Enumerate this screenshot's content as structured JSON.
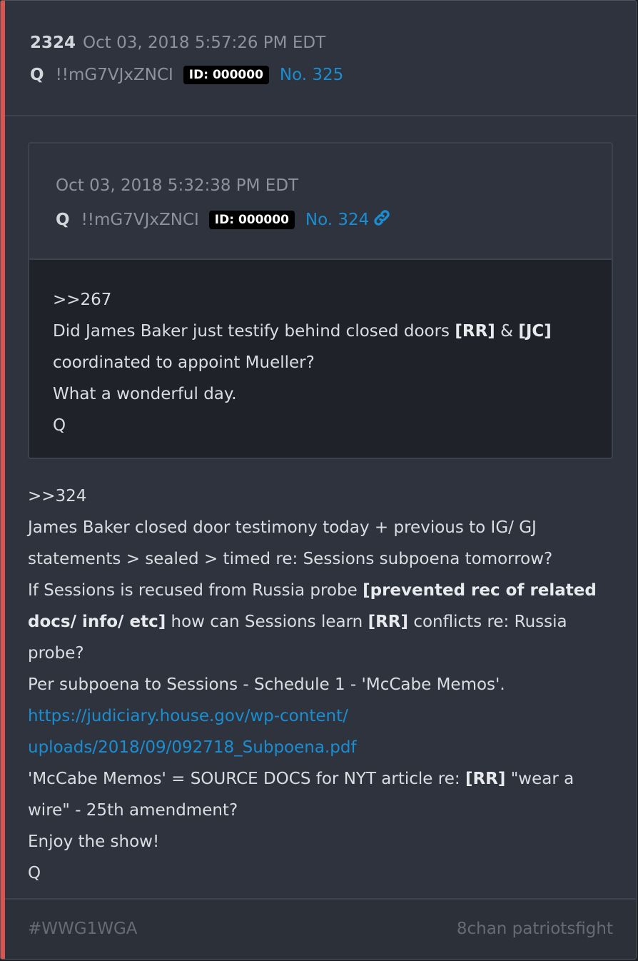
{
  "post": {
    "number": "2324",
    "date": "Oct 03, 2018 5:57:26 PM EDT",
    "author": "Q",
    "tripcode": "!!mG7VJxZNCI",
    "id_badge": "ID: 000000",
    "post_no": "No. 325"
  },
  "quoted": {
    "date": "Oct 03, 2018 5:32:38 PM EDT",
    "author": "Q",
    "tripcode": "!!mG7VJxZNCI",
    "id_badge": "ID: 000000",
    "post_no": "No. 324",
    "link_icon": "link-icon",
    "lines": {
      "l1": ">>267",
      "l2a": "Did James Baker just testify behind closed doors ",
      "l2b": "[RR]",
      "l2c": " & ",
      "l2d": "[JC]",
      "l3": "coordinated to appoint Mueller?",
      "l4": "What a wonderful day.",
      "l5": "Q"
    }
  },
  "body": {
    "l1": ">>324",
    "l2": "James Baker closed door testimony today + previous to IG/ GJ",
    "l3": "statements > sealed > timed re: Sessions subpoena tomorrow?",
    "l4a": "If Sessions is recused from Russia probe ",
    "l4b": "[prevented rec of related",
    "l5a": "docs/ info/ etc]",
    "l5b": " how can Sessions learn ",
    "l5c": "[RR]",
    "l5d": " conflicts re: Russia",
    "l6": "probe?",
    "l7": "Per subpoena to Sessions - Schedule 1 - 'McCabe Memos'.",
    "link1": "https://judiciary.house.gov/wp-content/",
    "link2": "uploads/2018/09/092718_Subpoena.pdf",
    "l10a": "'McCabe Memos' = SOURCE DOCS for NYT article re: ",
    "l10b": "[RR]",
    "l10c": " \"wear a",
    "l11": "wire\" - 25th amendment?",
    "l12": "Enjoy the show!",
    "l13": "Q"
  },
  "footer": {
    "tag": "#WWG1WGA",
    "source": "8chan patriotsfight"
  },
  "colors": {
    "accent": "#d9534f",
    "link": "#1b8ed2",
    "card": "#2e333d"
  }
}
